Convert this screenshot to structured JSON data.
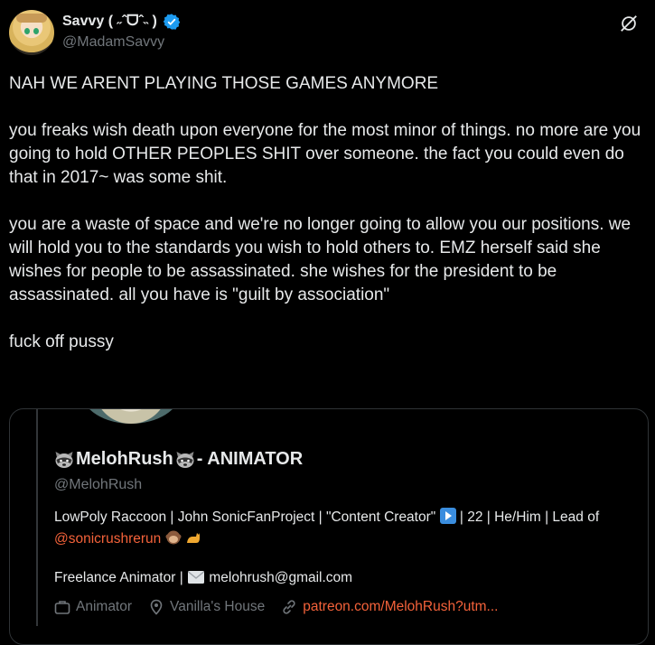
{
  "post": {
    "author": {
      "display_name": "Savvy ( ˶ˆᗜˆ˵ )",
      "handle": "@MadamSavvy",
      "verified": true
    },
    "paragraphs": [
      "NAH WE ARENT PLAYING THOSE GAMES ANYMORE",
      "you freaks wish death upon everyone for the most minor of things. no more are you going to hold OTHER PEOPLES SHIT over someone. the fact you could even do that in 2017~ was some shit.",
      "you are a waste of space and we're no longer going to allow you our positions. we will hold you to the standards you wish to hold others to. EMZ herself said she wishes for people to be assassinated. she wishes for the president to be assassinated. all you have is \"guilt by association\"",
      "fuck off pussy"
    ]
  },
  "quoted_profile": {
    "display_name": "MelohRush",
    "name_suffix": " - ANIMATOR",
    "handle": "@MelohRush",
    "bio_part1": "LowPoly Raccoon | John SonicFanProject | \"Content Creator\" ",
    "bio_part2": " | 22 | He/Him | Lead of ",
    "bio_mention": "@sonicrushrerun",
    "freelance_prefix": "Freelance Animator | ",
    "email": "melohrush@gmail.com",
    "meta": {
      "job": "Animator",
      "location": "Vanilla's House",
      "link": "patreon.com/MelohRush?utm..."
    }
  },
  "colors": {
    "background": "#000000",
    "text": "#e7e9ea",
    "muted": "#71767b",
    "verified": "#1d9bf0",
    "link": "#f4623a",
    "border": "#2f3336"
  },
  "icons": [
    "verified-icon",
    "grok-icon",
    "raccoon-icon",
    "play-button-icon",
    "monkey-icon",
    "cat-icon",
    "envelope-icon",
    "briefcase-icon",
    "location-icon",
    "link-icon"
  ]
}
